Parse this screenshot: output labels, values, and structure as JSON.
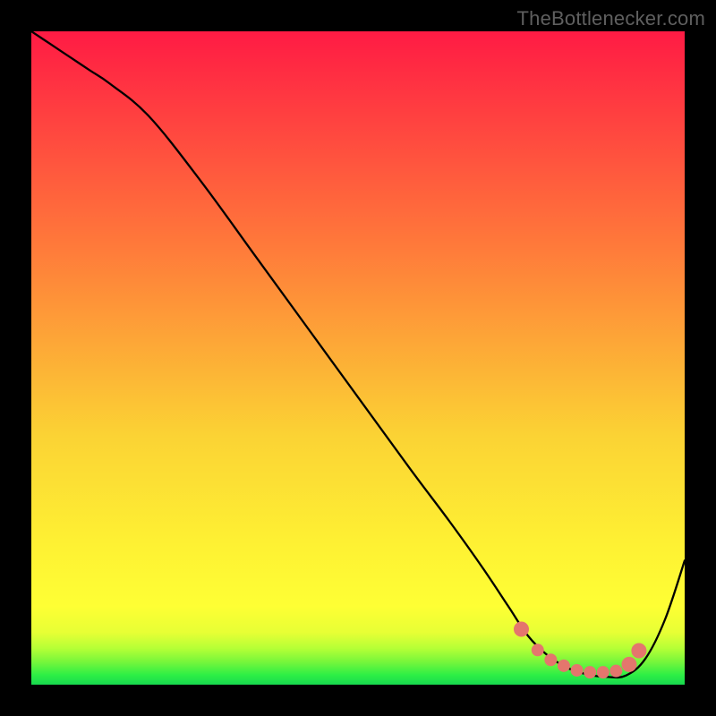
{
  "watermark": "TheBottlenecker.com",
  "chart_data": {
    "type": "line",
    "title": "",
    "xlabel": "",
    "ylabel": "",
    "xlim": [
      0,
      100
    ],
    "ylim": [
      0,
      100
    ],
    "grid": false,
    "background_gradient": {
      "stops": [
        {
          "offset": 0.0,
          "color": "#ff1b44"
        },
        {
          "offset": 0.33,
          "color": "#ff7a3a"
        },
        {
          "offset": 0.62,
          "color": "#fbd334"
        },
        {
          "offset": 0.78,
          "color": "#fef033"
        },
        {
          "offset": 0.88,
          "color": "#feff34"
        },
        {
          "offset": 0.92,
          "color": "#e7ff35"
        },
        {
          "offset": 0.945,
          "color": "#b4ff36"
        },
        {
          "offset": 0.965,
          "color": "#77f63b"
        },
        {
          "offset": 0.985,
          "color": "#2eef45"
        },
        {
          "offset": 1.0,
          "color": "#17d84e"
        }
      ]
    },
    "series": [
      {
        "name": "bottleneck-curve",
        "color": "#000000",
        "stroke_width": 2.3,
        "x": [
          0,
          3,
          6,
          9,
          12,
          18,
          26,
          34,
          42,
          50,
          58,
          64,
          69,
          73,
          76,
          79,
          82,
          85,
          88,
          91,
          94,
          97,
          100
        ],
        "y": [
          100,
          98,
          96,
          94,
          92,
          87,
          77,
          66,
          55,
          44,
          33,
          25,
          18,
          12,
          7.5,
          4.5,
          2.6,
          1.6,
          1.2,
          1.4,
          4.0,
          10,
          19
        ]
      }
    ],
    "markers": {
      "name": "optimal-zone",
      "color": "#e4766d",
      "stroke": "#e4766d",
      "radius_large": 8,
      "radius_small": 6.5,
      "points": [
        {
          "x": 75.0,
          "y": 8.5,
          "r": "large"
        },
        {
          "x": 77.5,
          "y": 5.3,
          "r": "small"
        },
        {
          "x": 79.5,
          "y": 3.8,
          "r": "small"
        },
        {
          "x": 81.5,
          "y": 2.9,
          "r": "small"
        },
        {
          "x": 83.5,
          "y": 2.2,
          "r": "small"
        },
        {
          "x": 85.5,
          "y": 1.9,
          "r": "small"
        },
        {
          "x": 87.5,
          "y": 1.9,
          "r": "small"
        },
        {
          "x": 89.5,
          "y": 2.1,
          "r": "small"
        },
        {
          "x": 91.5,
          "y": 3.1,
          "r": "large"
        },
        {
          "x": 93.0,
          "y": 5.2,
          "r": "large"
        }
      ]
    }
  }
}
